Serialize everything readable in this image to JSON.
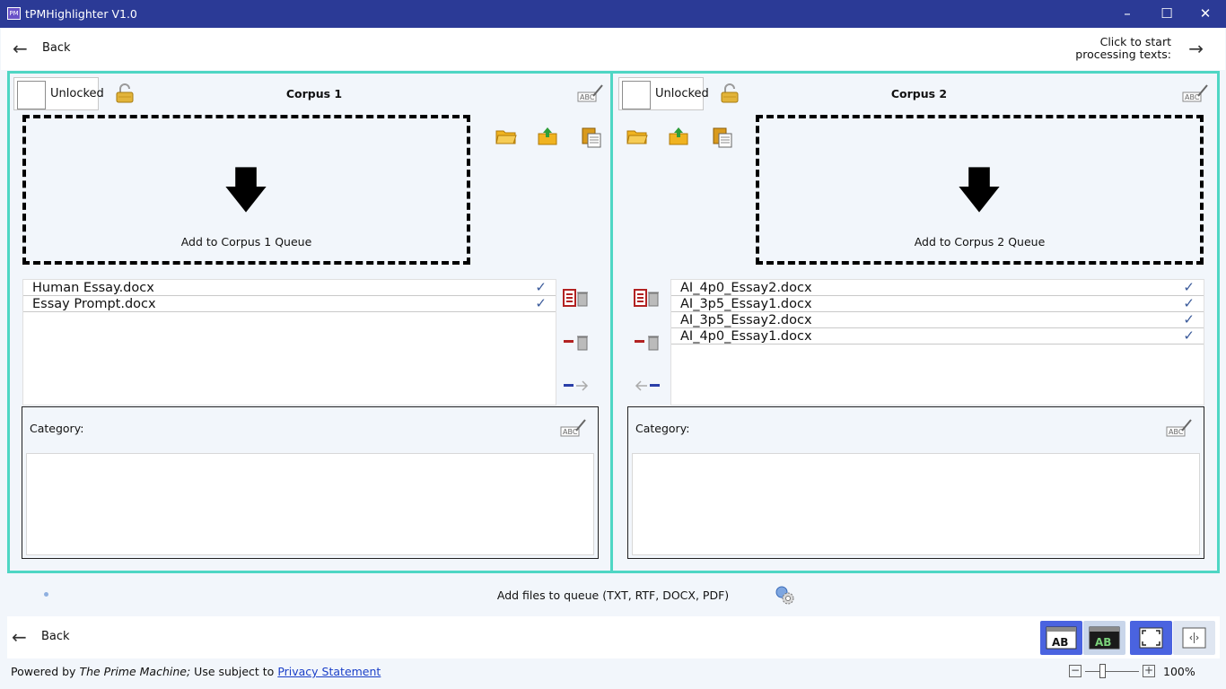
{
  "window": {
    "title": "tPMHighlighter V1.0",
    "icon_text": "PM",
    "minimize": "–",
    "maximize": "☐",
    "close": "✕"
  },
  "top_nav": {
    "back_label": "Back",
    "start_label": "Click to start processing texts:"
  },
  "corpus1": {
    "lock_label": "Unlocked",
    "title": "Corpus 1",
    "drop_label": "Add to Corpus 1 Queue",
    "files": [
      {
        "name": "Human Essay.docx",
        "checked": true
      },
      {
        "name": "Essay Prompt.docx",
        "checked": true
      }
    ],
    "category_label": "Category:",
    "category_text": ""
  },
  "corpus2": {
    "lock_label": "Unlocked",
    "title": "Corpus 2",
    "drop_label": "Add to Corpus 2 Queue",
    "files": [
      {
        "name": "AI_4p0_Essay2.docx",
        "checked": true
      },
      {
        "name": "AI_3p5_Essay1.docx",
        "checked": true
      },
      {
        "name": "AI_3p5_Essay2.docx",
        "checked": true
      },
      {
        "name": "AI_4p0_Essay1.docx",
        "checked": true
      }
    ],
    "category_label": "Category:",
    "category_text": ""
  },
  "status": {
    "text": "Add files to queue (TXT, RTF, DOCX, PDF)"
  },
  "bottom_nav": {
    "back_label": "Back"
  },
  "footer": {
    "powered_prefix": "Powered by",
    "product": "The Prime Machine;",
    "use_text": "Use subject to",
    "privacy_link": "Privacy Statement",
    "zoom": "100%"
  },
  "colors": {
    "titlebar": "#2b3a96",
    "accent": "#4fd6c4",
    "toolbar_active": "#4a63e0",
    "link": "#1a3fc8"
  }
}
